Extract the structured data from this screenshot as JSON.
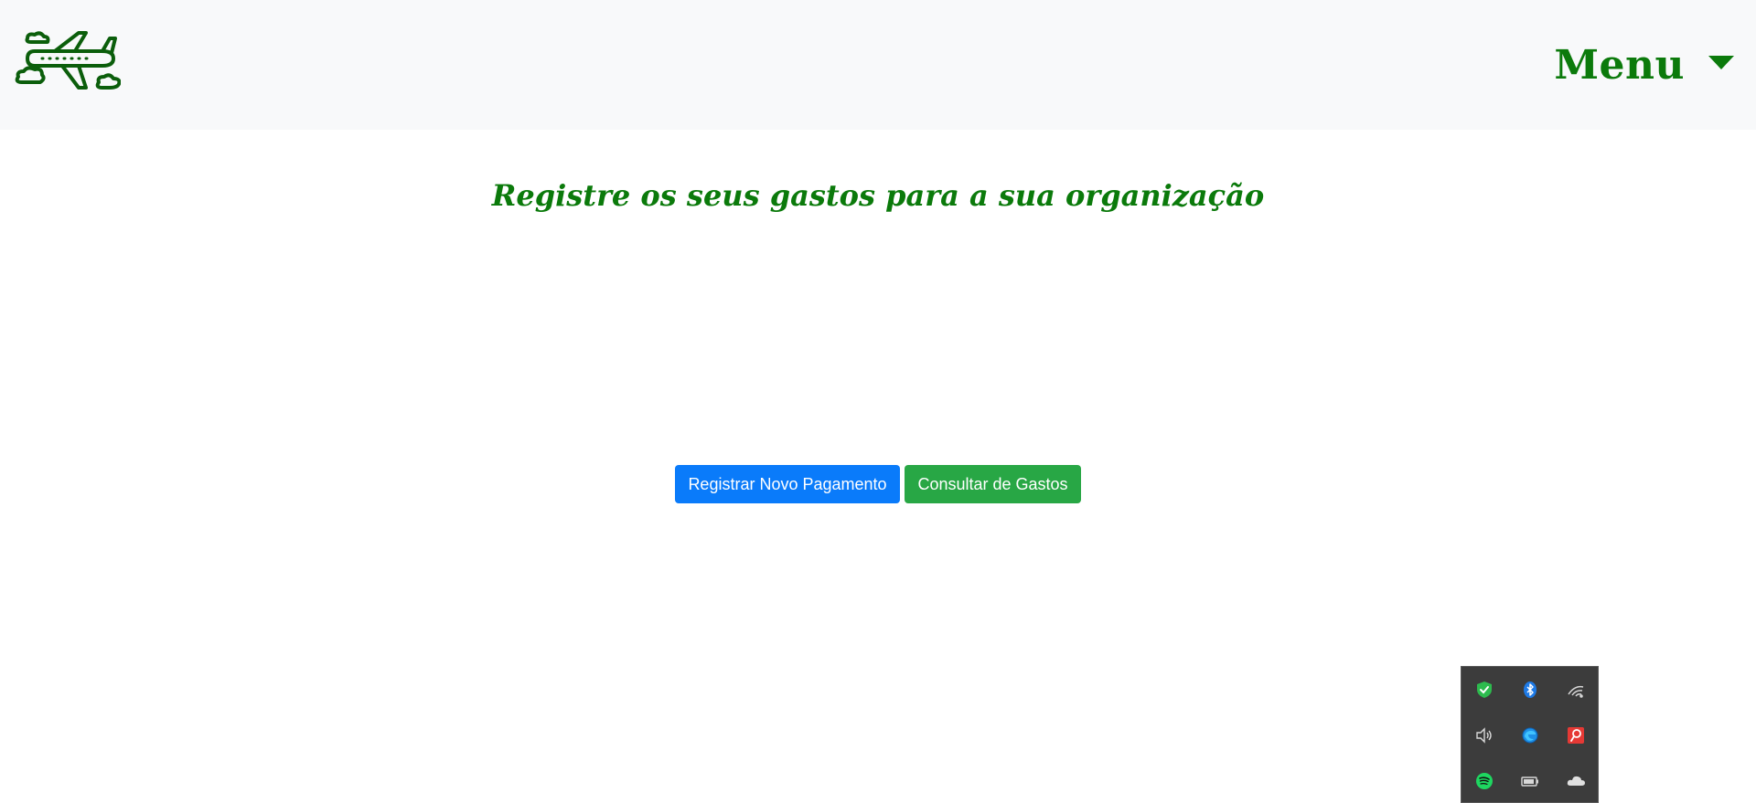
{
  "navbar": {
    "logo_icon": "airplane-clouds-icon",
    "menu_label": "Menu",
    "menu_caret_icon": "caret-down-icon"
  },
  "main": {
    "subtitle": "Registre os seus gastos para a sua organização",
    "buttons": {
      "register_payment": "Registrar Novo Pagamento",
      "consult_expenses": "Consultar de Gastos"
    }
  },
  "tray": {
    "icons": [
      "security-shield-icon",
      "bluetooth-icon",
      "wifi-icon",
      "volume-icon",
      "edge-browser-icon",
      "search-app-icon",
      "spotify-icon",
      "battery-icon",
      "onedrive-cloud-icon"
    ]
  },
  "colors": {
    "brand_green": "#0b7a0b",
    "navbar_bg": "#f8f9fa",
    "primary_blue": "#0a7bfa",
    "success_green": "#28a745",
    "tray_bg": "#3c3c3c"
  }
}
